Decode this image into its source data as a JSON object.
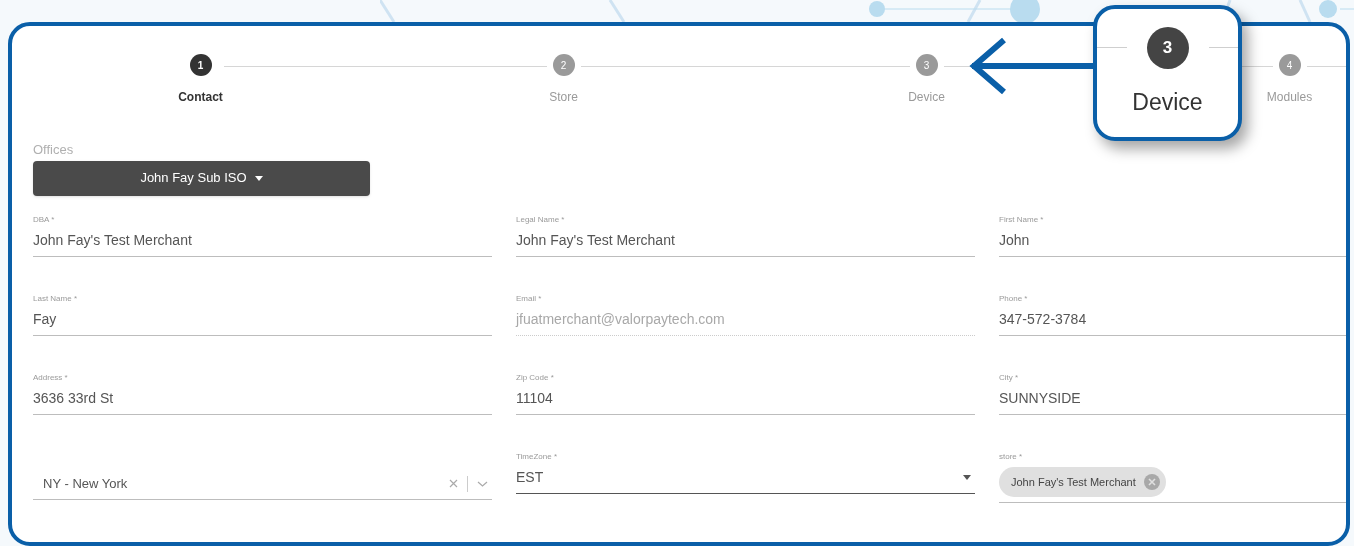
{
  "stepper": {
    "steps": [
      {
        "number": "1",
        "label": "Contact",
        "selected": true
      },
      {
        "number": "2",
        "label": "Store",
        "selected": false
      },
      {
        "number": "3",
        "label": "Device",
        "selected": false
      },
      {
        "number": "4",
        "label": "Modules",
        "selected": false
      }
    ]
  },
  "callout": {
    "number": "3",
    "label": "Device"
  },
  "offices": {
    "label": "Offices",
    "button": "John Fay Sub ISO"
  },
  "fields": [
    {
      "kind": "text",
      "label": "DBA *",
      "value": "John Fay's Test Merchant",
      "disabled": false
    },
    {
      "kind": "text",
      "label": "Legal Name *",
      "value": "John Fay's Test Merchant",
      "disabled": false
    },
    {
      "kind": "text",
      "label": "First Name *",
      "value": "John",
      "disabled": false
    },
    {
      "kind": "text",
      "label": "Last Name *",
      "value": "Fay",
      "disabled": false
    },
    {
      "kind": "text",
      "label": "Email *",
      "value": "jfuatmerchant@valorpaytech.com",
      "disabled": true
    },
    {
      "kind": "text",
      "label": "Phone *",
      "value": "347-572-3784",
      "disabled": false
    },
    {
      "kind": "text",
      "label": "Address *",
      "value": "3636 33rd St",
      "disabled": false
    },
    {
      "kind": "text",
      "label": "Zip Code *",
      "value": "11104",
      "disabled": false
    },
    {
      "kind": "text",
      "label": "City *",
      "value": "SUNNYSIDE",
      "disabled": false
    },
    {
      "kind": "combo",
      "value": "NY - New York",
      "disabled": false
    },
    {
      "kind": "select",
      "label": "TimeZone *",
      "value": "EST",
      "disabled": false
    },
    {
      "kind": "chips",
      "label": "store *",
      "chips": [
        "John Fay's Test Merchant"
      ],
      "disabled": false
    }
  ]
}
